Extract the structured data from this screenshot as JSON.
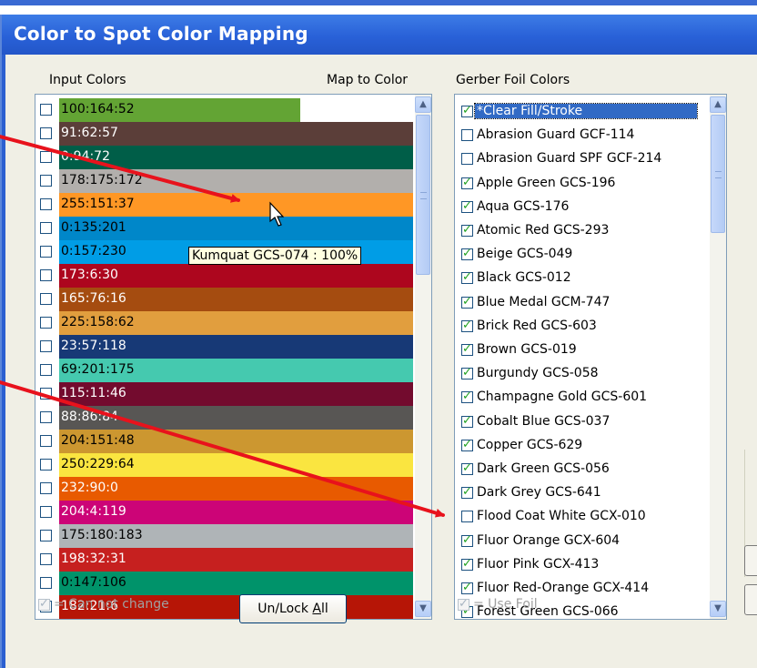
{
  "dialog": {
    "title": "Color to Spot Color Mapping"
  },
  "labels": {
    "input_colors": "Input Colors",
    "map_to_color": "Map to Color",
    "gerber_foil_colors": "Gerber Foil Colors"
  },
  "input_colors": [
    {
      "label": "100:164:52",
      "color": "#63a434",
      "swatch_end_fraction": 0.68,
      "text_color": "#000000"
    },
    {
      "label": "91:62:57",
      "color": "#5b3e39",
      "text_color": "#ffffff"
    },
    {
      "label": "0:94:72",
      "color": "#005e48",
      "text_color": "#ffffff"
    },
    {
      "label": "178:175:172",
      "color": "#b2afac",
      "text_color": "#000000"
    },
    {
      "label": "255:151:37",
      "color": "#ff9725",
      "text_color": "#000000"
    },
    {
      "label": "0:135:201",
      "color": "#0087c9",
      "text_color": "#000000"
    },
    {
      "label": "0:157:230",
      "color": "#009de6",
      "text_color": "#000000"
    },
    {
      "label": "173:6:30",
      "color": "#ad061e",
      "text_color": "#ffffff"
    },
    {
      "label": "165:76:16",
      "color": "#a54c10",
      "text_color": "#ffffff"
    },
    {
      "label": "225:158:62",
      "color": "#e19e3e",
      "text_color": "#000000"
    },
    {
      "label": "23:57:118",
      "color": "#173976",
      "text_color": "#ffffff"
    },
    {
      "label": "69:201:175",
      "color": "#45c9af",
      "text_color": "#000000"
    },
    {
      "label": "115:11:46",
      "color": "#730b2e",
      "text_color": "#ffffff"
    },
    {
      "label": "88:86:84",
      "color": "#585654",
      "text_color": "#ffffff"
    },
    {
      "label": "204:151:48",
      "color": "#cc9730",
      "text_color": "#000000"
    },
    {
      "label": "250:229:64",
      "color": "#fae540",
      "text_color": "#000000"
    },
    {
      "label": "232:90:0",
      "color": "#e85a00",
      "text_color": "#ffffff"
    },
    {
      "label": "204:4:119",
      "color": "#cc0477",
      "text_color": "#ffffff"
    },
    {
      "label": "175:180:183",
      "color": "#afb4b7",
      "text_color": "#000000"
    },
    {
      "label": "198:32:31",
      "color": "#c6201f",
      "text_color": "#ffffff"
    },
    {
      "label": "0:147:106",
      "color": "#00936a",
      "text_color": "#000000"
    },
    {
      "label": "182:21:6",
      "color": "#b61506",
      "text_color": "#ffffff"
    }
  ],
  "tooltip": "Kumquat GCS-074 : 100%",
  "foil_colors": [
    {
      "label": "*Clear Fill/Stroke",
      "checked": true,
      "selected": true
    },
    {
      "label": "Abrasion Guard GCF-114",
      "checked": false
    },
    {
      "label": "Abrasion Guard SPF GCF-214",
      "checked": false
    },
    {
      "label": "Apple Green GCS-196",
      "checked": true
    },
    {
      "label": "Aqua GCS-176",
      "checked": true
    },
    {
      "label": "Atomic Red GCS-293",
      "checked": true
    },
    {
      "label": "Beige GCS-049",
      "checked": true
    },
    {
      "label": "Black GCS-012",
      "checked": true
    },
    {
      "label": "Blue Medal GCM-747",
      "checked": true
    },
    {
      "label": "Brick Red GCS-603",
      "checked": true
    },
    {
      "label": "Brown GCS-019",
      "checked": true
    },
    {
      "label": "Burgundy GCS-058",
      "checked": true
    },
    {
      "label": "Champagne Gold GCS-601",
      "checked": true
    },
    {
      "label": "Cobalt Blue GCS-037",
      "checked": true
    },
    {
      "label": "Copper GCS-629",
      "checked": true
    },
    {
      "label": "Dark Green GCS-056",
      "checked": true
    },
    {
      "label": "Dark Grey GCS-641",
      "checked": true
    },
    {
      "label": "Flood Coat White GCX-010",
      "checked": false
    },
    {
      "label": "Fluor Orange GCX-604",
      "checked": true
    },
    {
      "label": "Fluor Pink GCX-413",
      "checked": true
    },
    {
      "label": "Fluor Red-Orange GCX-414",
      "checked": true
    },
    {
      "label": "Forest Green GCS-066",
      "checked": true
    }
  ],
  "legend": {
    "can_not_change": "= Can not change",
    "use_foil": "= Use Foil"
  },
  "buttons": {
    "unlock_all": "Un/Lock All",
    "unlock_all_prefix": "Un/Lock ",
    "unlock_all_accel": "A",
    "unlock_all_suffix": "ll"
  },
  "icons": [
    "scroll-up-icon",
    "scroll-down-icon",
    "mouse-cursor-icon",
    "arrow-annotation-icon"
  ],
  "annotation_color": "#e8121c"
}
